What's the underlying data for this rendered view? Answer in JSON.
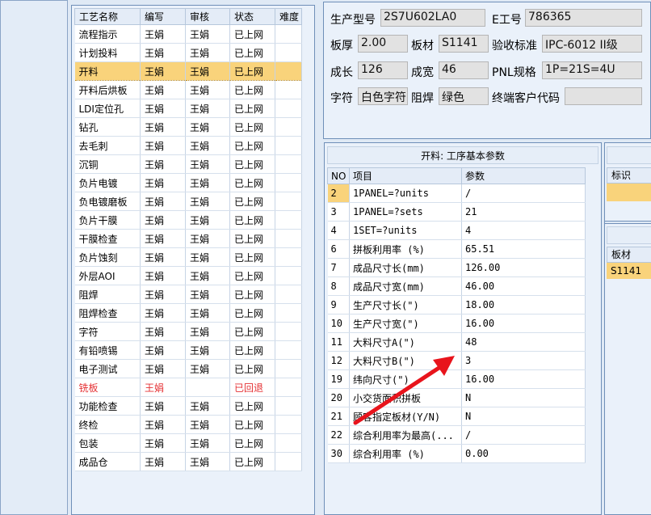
{
  "process_table": {
    "headers": [
      "工艺名称",
      "编写",
      "审核",
      "状态",
      "难度"
    ],
    "rows": [
      {
        "name": "流程指示",
        "writer": "王娟",
        "reviewer": "王娟",
        "status": "已上网",
        "difficulty": ""
      },
      {
        "name": "计划投料",
        "writer": "王娟",
        "reviewer": "王娟",
        "status": "已上网",
        "difficulty": ""
      },
      {
        "name": "开料",
        "writer": "王娟",
        "reviewer": "王娟",
        "status": "已上网",
        "difficulty": ""
      },
      {
        "name": "开料后烘板",
        "writer": "王娟",
        "reviewer": "王娟",
        "status": "已上网",
        "difficulty": ""
      },
      {
        "name": "LDI定位孔",
        "writer": "王娟",
        "reviewer": "王娟",
        "status": "已上网",
        "difficulty": ""
      },
      {
        "name": "钻孔",
        "writer": "王娟",
        "reviewer": "王娟",
        "status": "已上网",
        "difficulty": ""
      },
      {
        "name": "去毛刺",
        "writer": "王娟",
        "reviewer": "王娟",
        "status": "已上网",
        "difficulty": ""
      },
      {
        "name": "沉铜",
        "writer": "王娟",
        "reviewer": "王娟",
        "status": "已上网",
        "difficulty": ""
      },
      {
        "name": "负片电镀",
        "writer": "王娟",
        "reviewer": "王娟",
        "status": "已上网",
        "difficulty": ""
      },
      {
        "name": "负电镀磨板",
        "writer": "王娟",
        "reviewer": "王娟",
        "status": "已上网",
        "difficulty": ""
      },
      {
        "name": "负片干膜",
        "writer": "王娟",
        "reviewer": "王娟",
        "status": "已上网",
        "difficulty": ""
      },
      {
        "name": "干膜检查",
        "writer": "王娟",
        "reviewer": "王娟",
        "status": "已上网",
        "difficulty": ""
      },
      {
        "name": "负片蚀刻",
        "writer": "王娟",
        "reviewer": "王娟",
        "status": "已上网",
        "difficulty": ""
      },
      {
        "name": "外层AOI",
        "writer": "王娟",
        "reviewer": "王娟",
        "status": "已上网",
        "difficulty": ""
      },
      {
        "name": "阻焊",
        "writer": "王娟",
        "reviewer": "王娟",
        "status": "已上网",
        "difficulty": ""
      },
      {
        "name": "阻焊检查",
        "writer": "王娟",
        "reviewer": "王娟",
        "status": "已上网",
        "difficulty": ""
      },
      {
        "name": "字符",
        "writer": "王娟",
        "reviewer": "王娟",
        "status": "已上网",
        "difficulty": ""
      },
      {
        "name": "有铅喷锡",
        "writer": "王娟",
        "reviewer": "王娟",
        "status": "已上网",
        "difficulty": ""
      },
      {
        "name": "电子测试",
        "writer": "王娟",
        "reviewer": "王娟",
        "status": "已上网",
        "difficulty": ""
      },
      {
        "name": "铣板",
        "writer": "王娟",
        "reviewer": "",
        "status": "已回退",
        "difficulty": ""
      },
      {
        "name": "功能检查",
        "writer": "王娟",
        "reviewer": "王娟",
        "status": "已上网",
        "difficulty": ""
      },
      {
        "name": "终检",
        "writer": "王娟",
        "reviewer": "王娟",
        "status": "已上网",
        "difficulty": ""
      },
      {
        "name": "包装",
        "writer": "王娟",
        "reviewer": "王娟",
        "status": "已上网",
        "difficulty": ""
      },
      {
        "name": "成品仓",
        "writer": "王娟",
        "reviewer": "王娟",
        "status": "已上网",
        "difficulty": ""
      }
    ]
  },
  "info": {
    "model_label": "生产型号",
    "model_value": "2S7U602LA0",
    "eno_label": "E工号",
    "eno_value": "786365",
    "thickness_label": "板厚",
    "thickness_value": "2.00",
    "material_label": "板材",
    "material_value": "S1141",
    "standard_label": "验收标准",
    "standard_value": "IPC-6012 II级",
    "length_label": "成长",
    "length_value": "126",
    "width_label": "成宽",
    "width_value": "46",
    "pnl_label": "PNL规格",
    "pnl_value": "1P=21S=4U",
    "legend_label": "字符",
    "legend_value": "白色字符",
    "mask_label": "阻焊",
    "mask_value": "绿色",
    "customer_label": "终端客户代码",
    "customer_value": ""
  },
  "params": {
    "title": "开料: 工序基本参数",
    "headers": [
      "NO",
      "项目",
      "参数"
    ],
    "rows": [
      {
        "no": "2",
        "item": "1PANEL=?units",
        "value": "/"
      },
      {
        "no": "3",
        "item": "1PANEL=?sets",
        "value": "21"
      },
      {
        "no": "4",
        "item": "1SET=?units",
        "value": "4"
      },
      {
        "no": "6",
        "item": "拼板利用率 (%)",
        "value": "65.51"
      },
      {
        "no": "7",
        "item": "成品尺寸长(mm)",
        "value": "126.00"
      },
      {
        "no": "8",
        "item": "成品尺寸宽(mm)",
        "value": "46.00"
      },
      {
        "no": "9",
        "item": "生产尺寸长(\")",
        "value": "18.00"
      },
      {
        "no": "10",
        "item": "生产尺寸宽(\")",
        "value": "16.00"
      },
      {
        "no": "11",
        "item": "大料尺寸A(\")",
        "value": "48"
      },
      {
        "no": "12",
        "item": "大料尺寸B(\")",
        "value": "3"
      },
      {
        "no": "19",
        "item": "纬向尺寸(\")",
        "value": "16.00"
      },
      {
        "no": "20",
        "item": "小交货面积拼板",
        "value": "N"
      },
      {
        "no": "21",
        "item": "顾客指定板材(Y/N)",
        "value": "N"
      },
      {
        "no": "22",
        "item": "综合利用率为最高(...",
        "value": "/"
      },
      {
        "no": "30",
        "item": "综合利用率 (%)",
        "value": "0.00"
      }
    ]
  },
  "right_panel": {
    "mark_label": "标识",
    "material_label": "板材",
    "material_value": "S1141"
  },
  "colors": {
    "selected_row": "#f9d37b",
    "returned_status": "#e53235",
    "arrow": "#e8141c"
  }
}
